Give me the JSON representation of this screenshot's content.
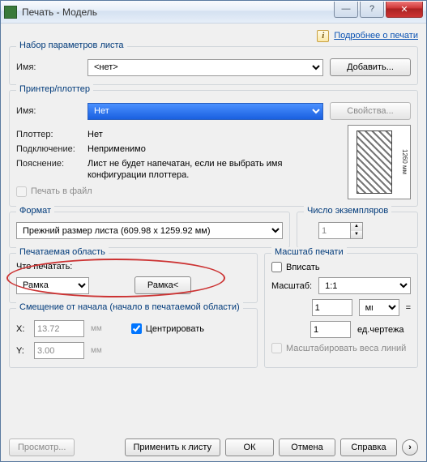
{
  "window": {
    "title": "Печать - Модель"
  },
  "help_link": "Подробнее о печати",
  "pageset": {
    "legend": "Набор параметров листа",
    "name_label": "Имя:",
    "name_value": "<нет>",
    "add_btn": "Добавить..."
  },
  "printer": {
    "legend": "Принтер/плоттер",
    "name_label": "Имя:",
    "name_value": "Нет",
    "props_btn": "Свойства...",
    "plotter_label": "Плоттер:",
    "plotter_value": "Нет",
    "conn_label": "Подключение:",
    "conn_value": "Неприменимо",
    "desc_label": "Пояснение:",
    "desc_value": "Лист не будет напечатан, если не выбрать имя конфигурации плоттера.",
    "tofile": "Печать в файл",
    "preview_dim": "1260 мм"
  },
  "format": {
    "legend": "Формат",
    "value": "Прежний размер листа (609.98 x 1259.92 мм)"
  },
  "copies": {
    "legend": "Число экземпляров",
    "value": "1"
  },
  "area": {
    "legend": "Печатаемая область",
    "what_label": "Что печатать:",
    "what_value": "Рамка",
    "frame_btn": "Рамка<"
  },
  "scale": {
    "legend": "Масштаб печати",
    "fit": "Вписать",
    "scale_label": "Масштаб:",
    "scale_value": "1:1",
    "num": "1",
    "unit": "мм",
    "den": "1",
    "den_unit": "ед.чертежа",
    "weights": "Масштабировать веса линий"
  },
  "offset": {
    "legend": "Смещение от начала (начало в печатаемой области)",
    "x_label": "X:",
    "x_value": "13.72",
    "y_label": "Y:",
    "y_value": "3.00",
    "unit": "мм",
    "center": "Центрировать"
  },
  "footer": {
    "preview": "Просмотр...",
    "apply": "Применить к листу",
    "ok": "ОК",
    "cancel": "Отмена",
    "help": "Справка"
  }
}
